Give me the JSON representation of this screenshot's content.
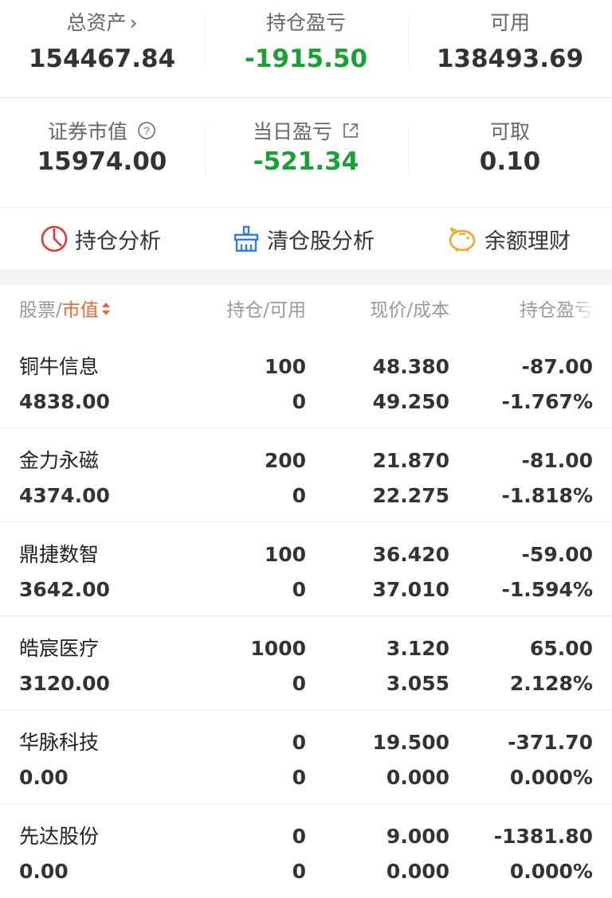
{
  "summary": {
    "total_assets": {
      "label": "总资产",
      "value": "154467.84"
    },
    "position_pl": {
      "label": "持仓盈亏",
      "value": "-1915.50"
    },
    "available": {
      "label": "可用",
      "value": "138493.69"
    },
    "securities_value": {
      "label": "证券市值",
      "value": "15974.00"
    },
    "daily_pl": {
      "label": "当日盈亏",
      "value": "-521.34"
    },
    "withdrawable": {
      "label": "可取",
      "value": "0.10"
    }
  },
  "tools": [
    {
      "label": "持仓分析",
      "icon": "pie-chart-icon"
    },
    {
      "label": "清仓股分析",
      "icon": "broom-icon"
    },
    {
      "label": "余额理财",
      "icon": "piggy-bank-icon"
    }
  ],
  "table": {
    "headers": {
      "stock": "股票",
      "separator": "/",
      "market_value": "市值",
      "holding": "持仓/可用",
      "price": "现价/成本",
      "pl": "持仓盈亏"
    },
    "rows": [
      {
        "name": "铜牛信息",
        "market_value": "4838.00",
        "holding": "100",
        "available": "0",
        "price": "48.380",
        "cost": "49.250",
        "pl": "-87.00",
        "pct": "-1.767%",
        "trend": "down"
      },
      {
        "name": "金力永磁",
        "market_value": "4374.00",
        "holding": "200",
        "available": "0",
        "price": "21.870",
        "cost": "22.275",
        "pl": "-81.00",
        "pct": "-1.818%",
        "trend": "down"
      },
      {
        "name": "鼎捷数智",
        "market_value": "3642.00",
        "holding": "100",
        "available": "0",
        "price": "36.420",
        "cost": "37.010",
        "pl": "-59.00",
        "pct": "-1.594%",
        "trend": "down"
      },
      {
        "name": "皓宸医疗",
        "market_value": "3120.00",
        "holding": "1000",
        "available": "0",
        "price": "3.120",
        "cost": "3.055",
        "pl": "65.00",
        "pct": "2.128%",
        "trend": "up"
      },
      {
        "name": "华脉科技",
        "market_value": "0.00",
        "holding": "0",
        "available": "0",
        "price": "19.500",
        "cost": "0.000",
        "pl": "-371.70",
        "pct": "0.000%",
        "trend": "down"
      },
      {
        "name": "先达股份",
        "market_value": "0.00",
        "holding": "0",
        "available": "0",
        "price": "9.000",
        "cost": "0.000",
        "pl": "-1381.80",
        "pct": "0.000%",
        "trend": "down"
      }
    ]
  },
  "colors": {
    "gain": "#e5333a",
    "loss": "#1aa136",
    "accent": "#f0642d"
  }
}
